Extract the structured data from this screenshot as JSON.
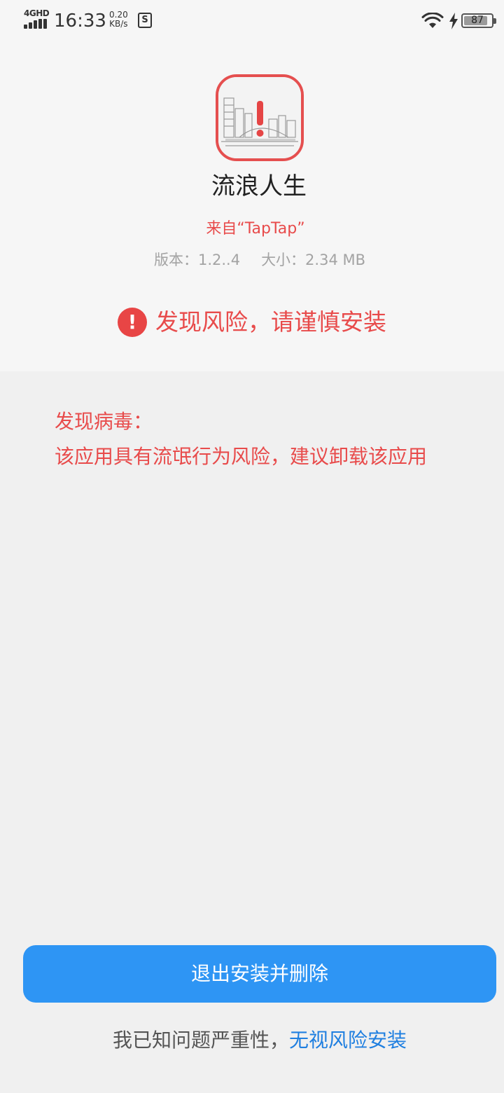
{
  "status_bar": {
    "network_label": "4GHD",
    "time": "16:33",
    "speed_value": "0.20",
    "speed_unit": "KB/s",
    "s_icon_letter": "S",
    "battery_level": "87",
    "battery_fraction": 0.87
  },
  "app": {
    "icon": "app-icon-with-warning",
    "name": "流浪人生",
    "source": "来自“TapTap”",
    "version": "版本：1.2..4",
    "size": "大小：2.34 MB"
  },
  "risk_banner": {
    "icon": "exclamation-circle-icon",
    "icon_glyph": "!",
    "text": "发现风险，请谨慎安装"
  },
  "virus_info": {
    "title": "发现病毒：",
    "description": "该应用具有流氓行为风险，建议卸载该应用"
  },
  "actions": {
    "exit_label": "退出安装并删除",
    "ignore_prefix": "我已知问题严重性，",
    "ignore_link": "无视风险安装"
  },
  "colors": {
    "danger": "#e84b4b",
    "primary": "#2e95f4",
    "link": "#1f7fe0",
    "background": "#f0f0f0",
    "card": "#f6f6f6"
  }
}
